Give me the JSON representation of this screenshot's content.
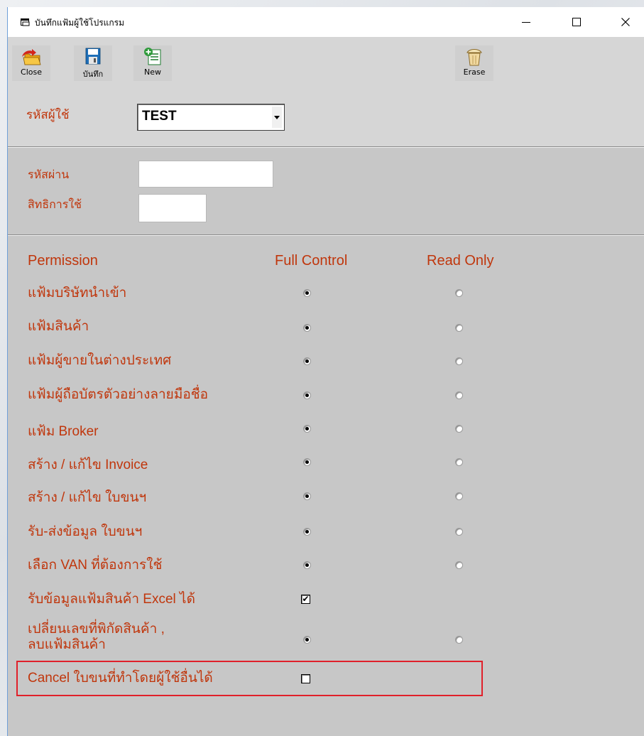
{
  "window": {
    "title": "บันทึกแฟ้มผู้ใช้โปรแกรม",
    "minimize_glyph": "—",
    "maximize_glyph": "☐",
    "close_glyph": "✕"
  },
  "toolbar": {
    "close_label": "Close",
    "save_label": "บันทึก",
    "new_label": "New",
    "erase_label": "Erase"
  },
  "user": {
    "label": "รหัสผู้ใช้",
    "value": "TEST"
  },
  "credentials": {
    "password_label": "รหัสผ่าน",
    "password_value": "",
    "rights_label": "สิทธิการใช้",
    "rights_value": ""
  },
  "permissions": {
    "header_permission": "Permission",
    "header_full": "Full Control",
    "header_read": "Read Only",
    "rows": [
      {
        "label": "แฟ้มบริษัทนำเข้า",
        "type": "radio",
        "selected": "full"
      },
      {
        "label": "แฟ้มสินค้า",
        "type": "radio",
        "selected": "full"
      },
      {
        "label": "แฟ้มผู้ขายในต่างประเทศ",
        "type": "radio",
        "selected": "full"
      },
      {
        "label": "แฟ้มผู้ถือบัตรตัวอย่างลายมือชื่อ",
        "type": "radio",
        "selected": "full"
      },
      {
        "label": "แฟ้ม Broker",
        "type": "radio",
        "selected": "full"
      },
      {
        "label": "สร้าง / แก้ไข Invoice",
        "type": "radio",
        "selected": "full"
      },
      {
        "label": "สร้าง / แก้ไข ใบขนฯ",
        "type": "radio",
        "selected": "full"
      },
      {
        "label": "รับ-ส่งข้อมูล ใบขนฯ",
        "type": "radio",
        "selected": "full"
      },
      {
        "label": "เลือก VAN ที่ต้องการใช้",
        "type": "radio",
        "selected": "full"
      },
      {
        "label": "รับข้อมูลแฟ้มสินค้า Excel ได้",
        "type": "checkbox",
        "checked": true
      },
      {
        "label_line1": "เปลี่ยนเลขที่พิกัดสินค้า ,",
        "label_line2": "ลบแฟ้มสินค้า",
        "type": "radio",
        "selected": "full"
      },
      {
        "label": "Cancel ใบขนที่ทำโดยผู้ใช้อื่นได้",
        "type": "checkbox",
        "checked": false
      }
    ],
    "check_mark": "✔"
  }
}
